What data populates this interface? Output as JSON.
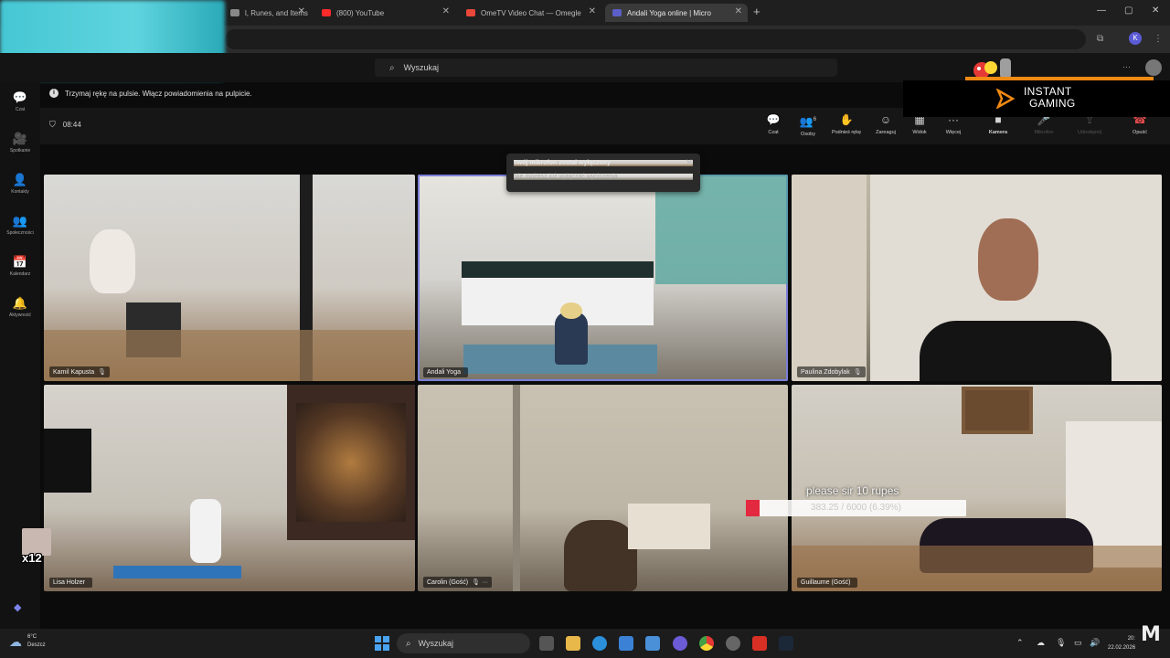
{
  "browser": {
    "tabs": [
      {
        "label": "l, Runes, and Items",
        "color": "#888888"
      },
      {
        "label": "(800) YouTube",
        "color": "#ff2a2a"
      },
      {
        "label": "OmeTV Video Chat — Omegle",
        "color": "#e8473a"
      },
      {
        "label": "Andali Yoga online | Micro",
        "color": "#5b5fc7"
      }
    ],
    "new_tab": "+",
    "window_controls": [
      "—",
      "▢",
      "✕"
    ],
    "profile_initial": "K"
  },
  "teams": {
    "search_placeholder": "Wyszukaj",
    "more": "···",
    "rail": [
      {
        "icon": "💬",
        "label": "Czat"
      },
      {
        "icon": "🎥",
        "label": "Spotkanie"
      },
      {
        "icon": "👤",
        "label": "Kontakty"
      },
      {
        "icon": "👥",
        "label": "Społeczności"
      },
      {
        "icon": "📅",
        "label": "Kalendarz"
      },
      {
        "icon": "🔔",
        "label": "Aktywność"
      }
    ],
    "notice": "Trzymaj rękę na pulsie. Włącz powiadomienia na pulpicie.",
    "notice_icon": "i",
    "timer": "08:44",
    "toolbar": [
      {
        "icon": "💬",
        "label": "Czat"
      },
      {
        "icon": "👥",
        "label": "Osoby",
        "badge": "6"
      },
      {
        "icon": "✋",
        "label": "Podnieś rękę"
      },
      {
        "icon": "☺",
        "label": "Zareaguj"
      },
      {
        "icon": "▦",
        "label": "Widok"
      },
      {
        "icon": "···",
        "label": "Więcej"
      },
      {
        "icon": "■",
        "label": "Kamera"
      },
      {
        "icon": "🎤",
        "label": "Mikrofon"
      },
      {
        "icon": "⇪",
        "label": "Udostępnij"
      },
      {
        "icon": "☎",
        "label": "Opuść"
      }
    ],
    "toast": {
      "title": "Twój mikrofon został wyłączony",
      "body": "Nie możesz już wyłączać wyciszenia.",
      "close": "✕"
    },
    "participants": [
      {
        "name": "Kamil Kapusta",
        "mic": "🎙"
      },
      {
        "name": "Andali Yoga",
        "mic": ""
      },
      {
        "name": "Paulina Zdobylak",
        "mic": "🎙"
      },
      {
        "name": "Lisa Holzer",
        "mic": ""
      },
      {
        "name": "Carolin (Gość)",
        "mic": "🎙 ···"
      },
      {
        "name": "Guillaume (Gość)",
        "mic": ""
      }
    ]
  },
  "overlays": {
    "multiplier": "x12",
    "donation_title": "please sir 10 rupes",
    "donation_progress": "383.25 / 6000 (6.39%)",
    "donation_fraction": 0.0639,
    "ig_brand_line1": "INSTANT",
    "ig_brand_line2": "GAMING",
    "watermark": "M"
  },
  "taskbar": {
    "temperature": "6°C",
    "weather": "Deszcz",
    "search": "Wyszukaj",
    "time": "20:",
    "date": "22.02.2026",
    "tray": [
      "⌃",
      "☁",
      "🎙",
      "▭",
      "🔊"
    ]
  }
}
